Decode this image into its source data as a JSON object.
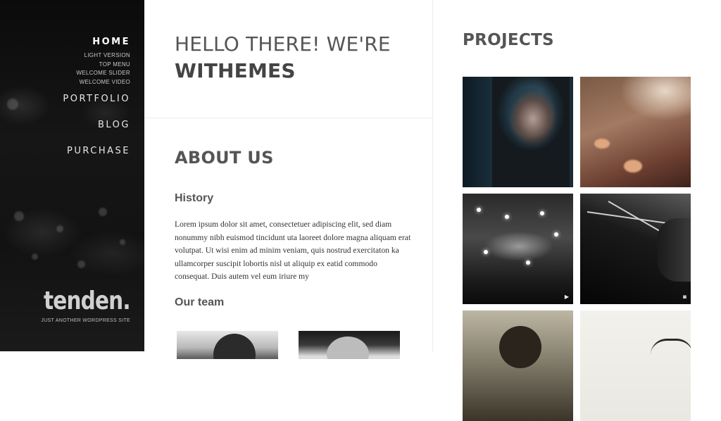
{
  "sidebar": {
    "nav": {
      "home": "HOME",
      "sub_items": [
        "LIGHT VERSION",
        "TOP MENU",
        "WELCOME SLIDER",
        "WELCOME VIDEO"
      ],
      "portfolio": "PORTFOLIO",
      "blog": "BLOG",
      "purchase": "PURCHASE"
    },
    "logo": "tenden.",
    "tagline": "JUST ANOTHER WORDPRESS SITE"
  },
  "intro": {
    "line1": "HELLO THERE! WE'RE",
    "line2": "WITHEMES"
  },
  "about": {
    "title": "ABOUT US",
    "history_heading": "History",
    "history_text": "Lorem ipsum dolor sit amet, consectetuer adipiscing elit, sed diam nonummy nibh euismod tincidunt uta laoreet dolore magna aliquam erat volutpat. Ut wisi enim ad minim veniam, quis nostrud exercitaton ka ullamcorper suscipit lobortis nisl ut aliquip ex eatid commodo consequat. Duis autem vel eum iriure my",
    "team_heading": "Our team"
  },
  "projects": {
    "title": "PROJECTS",
    "tiles": [
      {
        "icon": null
      },
      {
        "icon": null
      },
      {
        "icon": "video-icon",
        "glyph": "▶"
      },
      {
        "icon": "camera-icon",
        "glyph": "◙"
      },
      {
        "icon": null
      },
      {
        "icon": null
      }
    ]
  },
  "colors": {
    "sidebar_bg": "#111111",
    "heading_text": "#555555",
    "body_text": "#333333",
    "divider": "#ececec"
  }
}
